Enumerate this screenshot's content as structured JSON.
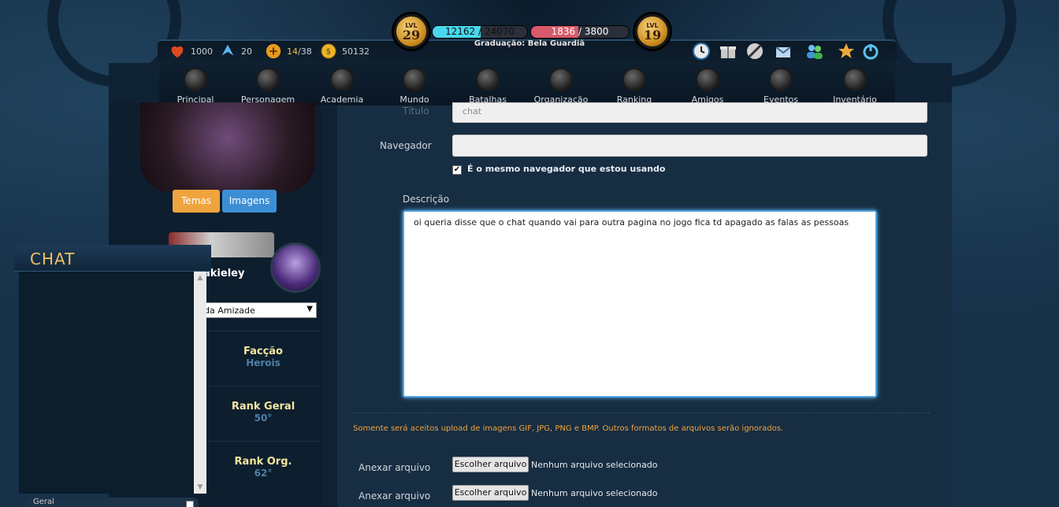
{
  "header": {
    "level_left": {
      "tag": "LVL",
      "value": "29"
    },
    "level_right": {
      "tag": "LVL",
      "value": "19"
    },
    "xp_bar": {
      "text": "12162 / 24070",
      "fill": 0.505
    },
    "hp_bar": {
      "text": "1836 / 3800",
      "fill": 0.483
    },
    "graduation": "Graduação: Bela Guardiã",
    "stats": [
      {
        "icon": "heart-icon",
        "value": "1000"
      },
      {
        "icon": "energy-icon",
        "value": "20"
      },
      {
        "icon": "stamina-icon",
        "value_highlight": "14",
        "value_rest": "/38"
      },
      {
        "icon": "gold-coin-icon",
        "value": "50132"
      }
    ],
    "tools": [
      "clock-icon",
      "gift-icon",
      "settings-icon",
      "mail-icon",
      "friends-icon",
      "star-icon",
      "power-icon"
    ]
  },
  "nav": [
    {
      "label": "Principal",
      "icon": "principal-icon"
    },
    {
      "label": "Personagem",
      "icon": "personagem-icon"
    },
    {
      "label": "Academia",
      "icon": "academia-icon"
    },
    {
      "label": "Mundo",
      "icon": "mundo-icon"
    },
    {
      "label": "Batalhas",
      "icon": "batalhas-icon"
    },
    {
      "label": "Organização",
      "icon": "organizacao-icon"
    },
    {
      "label": "Ranking",
      "icon": "ranking-icon"
    },
    {
      "label": "Amigos",
      "icon": "amigos-icon"
    },
    {
      "label": "Eventos",
      "icon": "eventos-icon"
    },
    {
      "label": "Inventário",
      "icon": "inventario-icon"
    }
  ],
  "profile": {
    "temas_label": "Temas",
    "imagens_label": "Imagens",
    "username": "akieley",
    "friend_select": "da Amizade",
    "faccao_label": "Facção",
    "faccao_value": "Herois",
    "rank_geral_label": "Rank Geral",
    "rank_geral_value": "50°",
    "rank_org_label": "Rank Org.",
    "rank_org_value": "62°"
  },
  "chat": {
    "title": "CHAT",
    "channel": "Geral"
  },
  "form": {
    "titulo_label": "Título",
    "titulo_value": "chat",
    "navegador_label": "Navegador",
    "navegador_value": "",
    "same_browser_label": "É o mesmo navegador que estou usando",
    "same_browser_checked": true,
    "descricao_label": "Descrição",
    "descricao_value": "oi queria disse que o chat quando vai para outra pagina no jogo fica td apagado as falas as pessoas",
    "upload_warning": "Somente será aceitos upload de imagens GIF, JPG, PNG e BMP. Outros formatos de arquivos serão ignorados.",
    "attachments": [
      {
        "label": "Anexar arquivo",
        "button": "Escolher arquivo",
        "status": "Nenhum arquivo selecionado"
      },
      {
        "label": "Anexar arquivo",
        "button": "Escolher arquivo",
        "status": "Nenhum arquivo selecionado"
      }
    ]
  },
  "colors": {
    "accent_orange": "#f0a43e",
    "accent_blue": "#3c8ed4",
    "xp_fill": "#48d7ee",
    "hp_fill": "#d85a6a"
  }
}
